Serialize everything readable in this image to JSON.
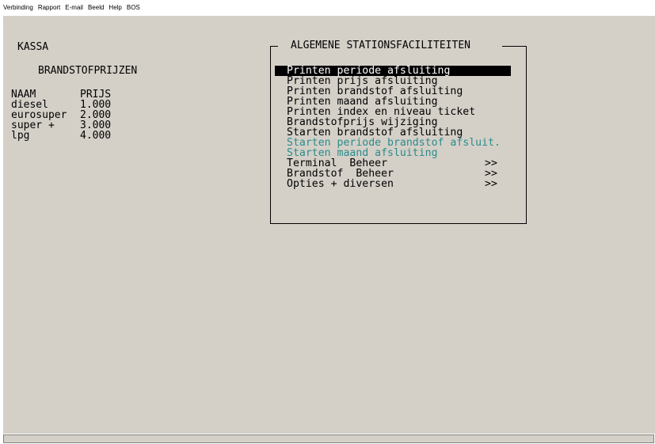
{
  "menubar": {
    "items": [
      "Verbinding",
      "Rapport",
      "E-mail",
      "Beeld",
      "Help",
      "BOS"
    ]
  },
  "left": {
    "title": "KASSA",
    "subtitle": "BRANDSTOFPRIJZEN",
    "headers": {
      "name": "NAAM",
      "price": "PRIJS"
    },
    "rows": [
      {
        "name": "diesel",
        "price": "1.000"
      },
      {
        "name": "eurosuper",
        "price": "2.000"
      },
      {
        "name": "super +",
        "price": "3.000"
      },
      {
        "name": "lpg",
        "price": "4.000"
      }
    ]
  },
  "menu": {
    "title": "ALGEMENE STATIONSFACILITEITEN",
    "items": [
      {
        "label": "Printen periode afsluiting",
        "state": "selected",
        "arrow": ""
      },
      {
        "label": "Printen prijs afsluiting",
        "state": "normal",
        "arrow": ""
      },
      {
        "label": "Printen brandstof afsluiting",
        "state": "normal",
        "arrow": ""
      },
      {
        "label": "Printen maand afsluiting",
        "state": "normal",
        "arrow": ""
      },
      {
        "label": "Printen index en niveau ticket",
        "state": "normal",
        "arrow": ""
      },
      {
        "label": "Brandstofprijs wijziging",
        "state": "normal",
        "arrow": ""
      },
      {
        "label": "Starten brandstof afsluiting",
        "state": "normal",
        "arrow": ""
      },
      {
        "label": "Starten periode brandstof afsluit.",
        "state": "disabled",
        "arrow": ""
      },
      {
        "label": "Starten maand afsluiting",
        "state": "disabled",
        "arrow": ""
      },
      {
        "label": "Terminal  Beheer",
        "state": "normal",
        "arrow": ">>"
      },
      {
        "label": "Brandstof  Beheer",
        "state": "normal",
        "arrow": ">>"
      },
      {
        "label": "Opties + diversen",
        "state": "normal",
        "arrow": ">>"
      }
    ]
  },
  "colors": {
    "screen": "#d4d0c8",
    "disabled_text": "#2a8c8c",
    "selected_bg": "#000000"
  }
}
